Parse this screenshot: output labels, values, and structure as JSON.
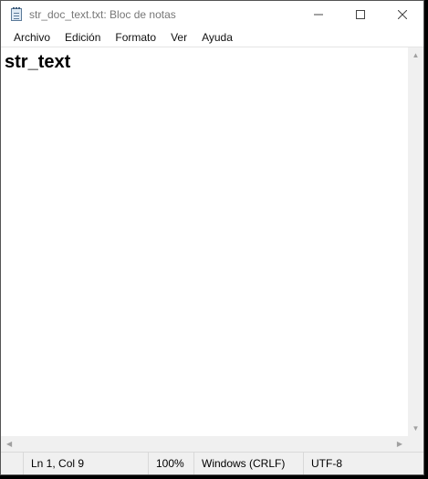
{
  "window": {
    "title": "str_doc_text.txt: Bloc de notas",
    "controls": {
      "minimize_icon": "minimize-icon",
      "maximize_icon": "maximize-icon",
      "close_icon": "close-icon"
    }
  },
  "menu": {
    "items": [
      "Archivo",
      "Edición",
      "Formato",
      "Ver",
      "Ayuda"
    ]
  },
  "editor": {
    "content": "str_text"
  },
  "scrollbars": {
    "up_icon": "▲",
    "down_icon": "▼",
    "left_icon": "◀",
    "right_icon": "▶"
  },
  "status": {
    "position": "Ln 1, Col 9",
    "zoom": "100%",
    "line_ending": "Windows (CRLF)",
    "encoding": "UTF-8"
  }
}
